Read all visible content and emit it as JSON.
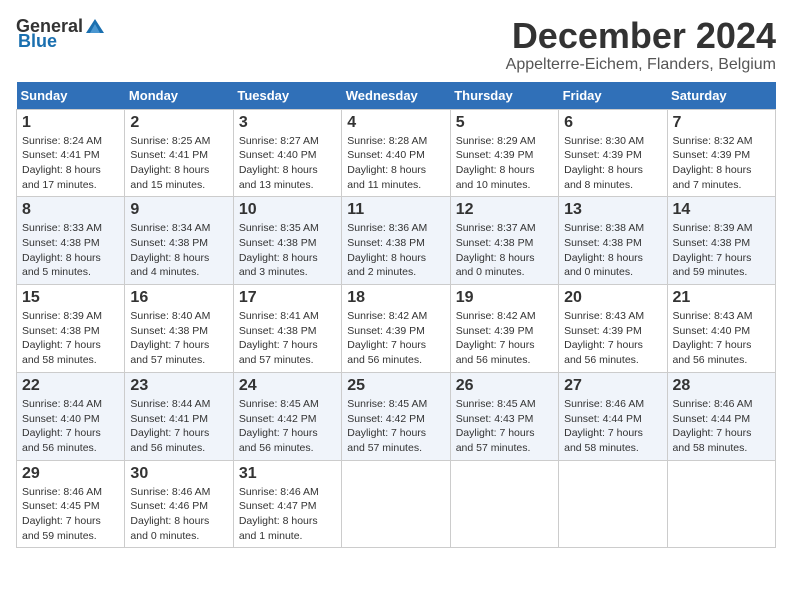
{
  "header": {
    "logo_general": "General",
    "logo_blue": "Blue",
    "month_title": "December 2024",
    "location": "Appelterre-Eichem, Flanders, Belgium"
  },
  "days_of_week": [
    "Sunday",
    "Monday",
    "Tuesday",
    "Wednesday",
    "Thursday",
    "Friday",
    "Saturday"
  ],
  "weeks": [
    [
      {
        "day": "1",
        "sunrise": "8:24 AM",
        "sunset": "4:41 PM",
        "daylight": "8 hours and 17 minutes."
      },
      {
        "day": "2",
        "sunrise": "8:25 AM",
        "sunset": "4:41 PM",
        "daylight": "8 hours and 15 minutes."
      },
      {
        "day": "3",
        "sunrise": "8:27 AM",
        "sunset": "4:40 PM",
        "daylight": "8 hours and 13 minutes."
      },
      {
        "day": "4",
        "sunrise": "8:28 AM",
        "sunset": "4:40 PM",
        "daylight": "8 hours and 11 minutes."
      },
      {
        "day": "5",
        "sunrise": "8:29 AM",
        "sunset": "4:39 PM",
        "daylight": "8 hours and 10 minutes."
      },
      {
        "day": "6",
        "sunrise": "8:30 AM",
        "sunset": "4:39 PM",
        "daylight": "8 hours and 8 minutes."
      },
      {
        "day": "7",
        "sunrise": "8:32 AM",
        "sunset": "4:39 PM",
        "daylight": "8 hours and 7 minutes."
      }
    ],
    [
      {
        "day": "8",
        "sunrise": "8:33 AM",
        "sunset": "4:38 PM",
        "daylight": "8 hours and 5 minutes."
      },
      {
        "day": "9",
        "sunrise": "8:34 AM",
        "sunset": "4:38 PM",
        "daylight": "8 hours and 4 minutes."
      },
      {
        "day": "10",
        "sunrise": "8:35 AM",
        "sunset": "4:38 PM",
        "daylight": "8 hours and 3 minutes."
      },
      {
        "day": "11",
        "sunrise": "8:36 AM",
        "sunset": "4:38 PM",
        "daylight": "8 hours and 2 minutes."
      },
      {
        "day": "12",
        "sunrise": "8:37 AM",
        "sunset": "4:38 PM",
        "daylight": "8 hours and 0 minutes."
      },
      {
        "day": "13",
        "sunrise": "8:38 AM",
        "sunset": "4:38 PM",
        "daylight": "8 hours and 0 minutes."
      },
      {
        "day": "14",
        "sunrise": "8:39 AM",
        "sunset": "4:38 PM",
        "daylight": "7 hours and 59 minutes."
      }
    ],
    [
      {
        "day": "15",
        "sunrise": "8:39 AM",
        "sunset": "4:38 PM",
        "daylight": "7 hours and 58 minutes."
      },
      {
        "day": "16",
        "sunrise": "8:40 AM",
        "sunset": "4:38 PM",
        "daylight": "7 hours and 57 minutes."
      },
      {
        "day": "17",
        "sunrise": "8:41 AM",
        "sunset": "4:38 PM",
        "daylight": "7 hours and 57 minutes."
      },
      {
        "day": "18",
        "sunrise": "8:42 AM",
        "sunset": "4:39 PM",
        "daylight": "7 hours and 56 minutes."
      },
      {
        "day": "19",
        "sunrise": "8:42 AM",
        "sunset": "4:39 PM",
        "daylight": "7 hours and 56 minutes."
      },
      {
        "day": "20",
        "sunrise": "8:43 AM",
        "sunset": "4:39 PM",
        "daylight": "7 hours and 56 minutes."
      },
      {
        "day": "21",
        "sunrise": "8:43 AM",
        "sunset": "4:40 PM",
        "daylight": "7 hours and 56 minutes."
      }
    ],
    [
      {
        "day": "22",
        "sunrise": "8:44 AM",
        "sunset": "4:40 PM",
        "daylight": "7 hours and 56 minutes."
      },
      {
        "day": "23",
        "sunrise": "8:44 AM",
        "sunset": "4:41 PM",
        "daylight": "7 hours and 56 minutes."
      },
      {
        "day": "24",
        "sunrise": "8:45 AM",
        "sunset": "4:42 PM",
        "daylight": "7 hours and 56 minutes."
      },
      {
        "day": "25",
        "sunrise": "8:45 AM",
        "sunset": "4:42 PM",
        "daylight": "7 hours and 57 minutes."
      },
      {
        "day": "26",
        "sunrise": "8:45 AM",
        "sunset": "4:43 PM",
        "daylight": "7 hours and 57 minutes."
      },
      {
        "day": "27",
        "sunrise": "8:46 AM",
        "sunset": "4:44 PM",
        "daylight": "7 hours and 58 minutes."
      },
      {
        "day": "28",
        "sunrise": "8:46 AM",
        "sunset": "4:44 PM",
        "daylight": "7 hours and 58 minutes."
      }
    ],
    [
      {
        "day": "29",
        "sunrise": "8:46 AM",
        "sunset": "4:45 PM",
        "daylight": "7 hours and 59 minutes."
      },
      {
        "day": "30",
        "sunrise": "8:46 AM",
        "sunset": "4:46 PM",
        "daylight": "8 hours and 0 minutes."
      },
      {
        "day": "31",
        "sunrise": "8:46 AM",
        "sunset": "4:47 PM",
        "daylight": "8 hours and 1 minute."
      },
      null,
      null,
      null,
      null
    ]
  ]
}
